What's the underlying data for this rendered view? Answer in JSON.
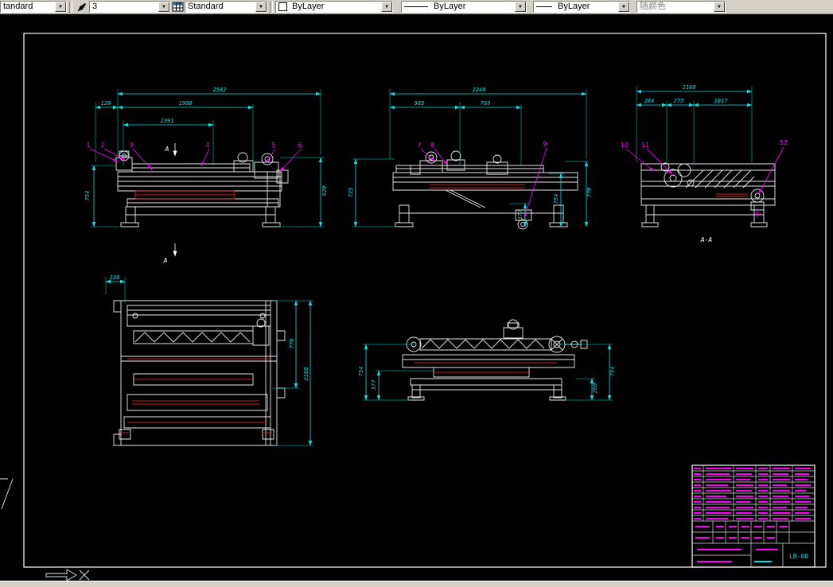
{
  "toolbar": {
    "text_style": "tandard",
    "dim_style": "3",
    "table_style": "Standard",
    "color": "ByLayer",
    "linetype": "ByLayer",
    "lineweight": "ByLayer",
    "plot_style": "随颜色",
    "dropdown_arrow": "▼"
  },
  "colors": {
    "canvas_bg": "#000000",
    "geometry": "#ffffff",
    "dimension": "#00e5e5",
    "callout": "#ff00ff",
    "detail": "#ff2a2a",
    "toolbar_bg": "#d4d0c8"
  },
  "drawing": {
    "views": {
      "front": {
        "dims_h": [
          "2582",
          "120",
          "1900",
          "2391"
        ],
        "dims_v": [
          "754",
          "920"
        ],
        "callouts": [
          "1",
          "2",
          "3",
          "4",
          "5",
          "6"
        ],
        "section_mark": "A"
      },
      "side": {
        "dims_h": [
          "2240",
          "985",
          "769"
        ],
        "dims_v": [
          "725",
          "779",
          "377",
          "754"
        ],
        "callouts": [
          "7",
          "8",
          "9"
        ]
      },
      "section": {
        "dims_h": [
          "2160",
          "284",
          "273",
          "1017"
        ],
        "callouts": [
          "10",
          "11",
          "12"
        ],
        "label": "A-A"
      },
      "plan": {
        "dims_h": [
          "130"
        ],
        "dims_v": [
          "770",
          "2160"
        ]
      },
      "rear": {
        "dims_v": [
          "754",
          "377",
          "754",
          "260"
        ]
      }
    },
    "title_block": {
      "drawing_number": "LB-00"
    }
  }
}
